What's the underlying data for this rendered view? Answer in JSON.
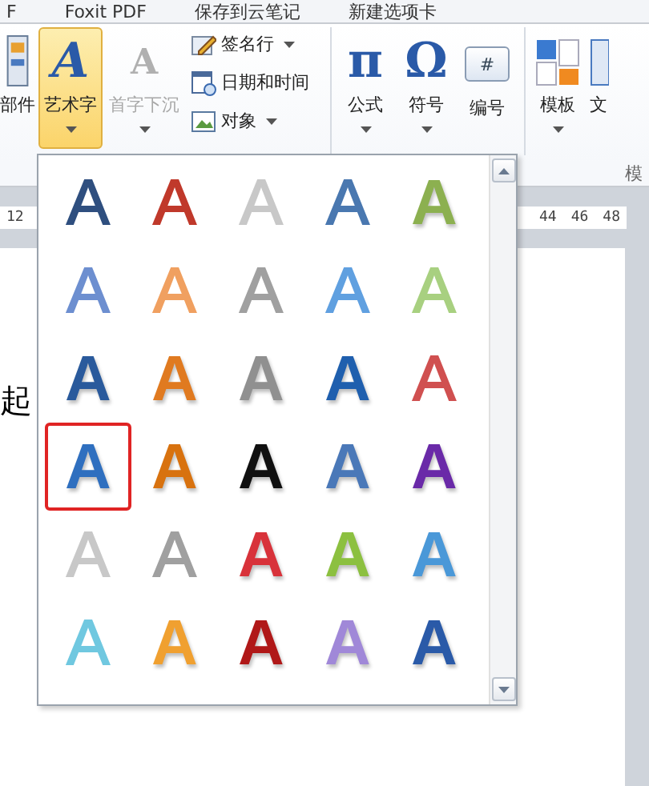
{
  "tabs": [
    {
      "label": "F"
    },
    {
      "label": "Foxit PDF"
    },
    {
      "label": "保存到云笔记"
    },
    {
      "label": "新建选项卡"
    }
  ],
  "ribbon": {
    "parts": {
      "label": "部件"
    },
    "wordart": {
      "glyph": "A",
      "label": "艺术字",
      "active": true,
      "disabled": false,
      "menu": true
    },
    "dropcap": {
      "glyph": "A",
      "label": "首字下沉",
      "active": false,
      "disabled": true,
      "menu": true
    },
    "small_buttons": [
      {
        "label": "签名行",
        "menu": true
      },
      {
        "label": "日期和时间",
        "menu": false
      },
      {
        "label": "对象",
        "menu": true
      }
    ],
    "equation": {
      "glyph": "π",
      "label": "公式",
      "menu": true
    },
    "symbol": {
      "glyph": "Ω",
      "label": "符号",
      "menu": true
    },
    "numbering": {
      "glyph": "#",
      "label": "编号",
      "menu": false
    },
    "template": {
      "label": "模板",
      "menu": true
    },
    "next": {
      "label": "文"
    },
    "group_label": "模"
  },
  "ruler": {
    "left_numbers": [
      "12"
    ],
    "right_numbers": [
      "44",
      "46",
      "48"
    ]
  },
  "document": {
    "text": "起"
  },
  "gallery": {
    "items": [
      {
        "text": "A",
        "kind": "outline",
        "color": "#2f4f7f",
        "selected": false
      },
      {
        "text": "A",
        "kind": "outline",
        "color": "#c0392b",
        "selected": false
      },
      {
        "text": "A",
        "kind": "outline",
        "color": "#c8c8c8",
        "selected": false
      },
      {
        "text": "A",
        "kind": "outline",
        "color": "#4a78b0",
        "selected": false
      },
      {
        "text": "A",
        "kind": "fill",
        "color": "#8cb050",
        "selected": false
      },
      {
        "text": "A",
        "kind": "outline",
        "color": "#6d8fd0",
        "selected": false
      },
      {
        "text": "A",
        "kind": "outline",
        "color": "#f0a060",
        "selected": false
      },
      {
        "text": "A",
        "kind": "outline",
        "color": "#a0a0a0",
        "selected": false
      },
      {
        "text": "A",
        "kind": "outline",
        "color": "#60a0e0",
        "selected": false
      },
      {
        "text": "A",
        "kind": "outline",
        "color": "#a8d080",
        "selected": false
      },
      {
        "text": "A",
        "kind": "fill",
        "color": "#2a5a9c",
        "selected": false
      },
      {
        "text": "A",
        "kind": "fill",
        "color": "#e07a20",
        "selected": false
      },
      {
        "text": "A",
        "kind": "fill",
        "color": "#909090",
        "selected": false
      },
      {
        "text": "A",
        "kind": "fill",
        "color": "#1f5fae",
        "selected": false
      },
      {
        "text": "A",
        "kind": "outline",
        "color": "#d05050",
        "selected": false
      },
      {
        "text": "A",
        "kind": "fill",
        "color": "#2f6fbf",
        "selected": true
      },
      {
        "text": "A",
        "kind": "fill",
        "color": "#d8720f",
        "selected": false
      },
      {
        "text": "A",
        "kind": "fill",
        "color": "#101010",
        "selected": false
      },
      {
        "text": "A",
        "kind": "fill",
        "color": "#4a78b8",
        "selected": false
      },
      {
        "text": "A",
        "kind": "fill",
        "color": "#6a2aa8",
        "selected": false
      },
      {
        "text": "A",
        "kind": "outline",
        "color": "#c8c8c8",
        "selected": false
      },
      {
        "text": "A",
        "kind": "outline",
        "color": "#a0a0a0",
        "selected": false
      },
      {
        "text": "A",
        "kind": "fill",
        "color": "#d8323a",
        "selected": false
      },
      {
        "text": "A",
        "kind": "fill",
        "color": "#8cc040",
        "selected": false
      },
      {
        "text": "A",
        "kind": "fill",
        "color": "#4a98d8",
        "selected": false
      },
      {
        "text": "A",
        "kind": "outline",
        "color": "#70c8e0",
        "selected": false
      },
      {
        "text": "A",
        "kind": "fill",
        "color": "#f0a030",
        "selected": false
      },
      {
        "text": "A",
        "kind": "fill",
        "color": "#b01818",
        "selected": false
      },
      {
        "text": "A",
        "kind": "fill",
        "color": "#a088d8",
        "selected": false
      },
      {
        "text": "A",
        "kind": "fill",
        "color": "#2a5aa8",
        "selected": false
      }
    ]
  }
}
